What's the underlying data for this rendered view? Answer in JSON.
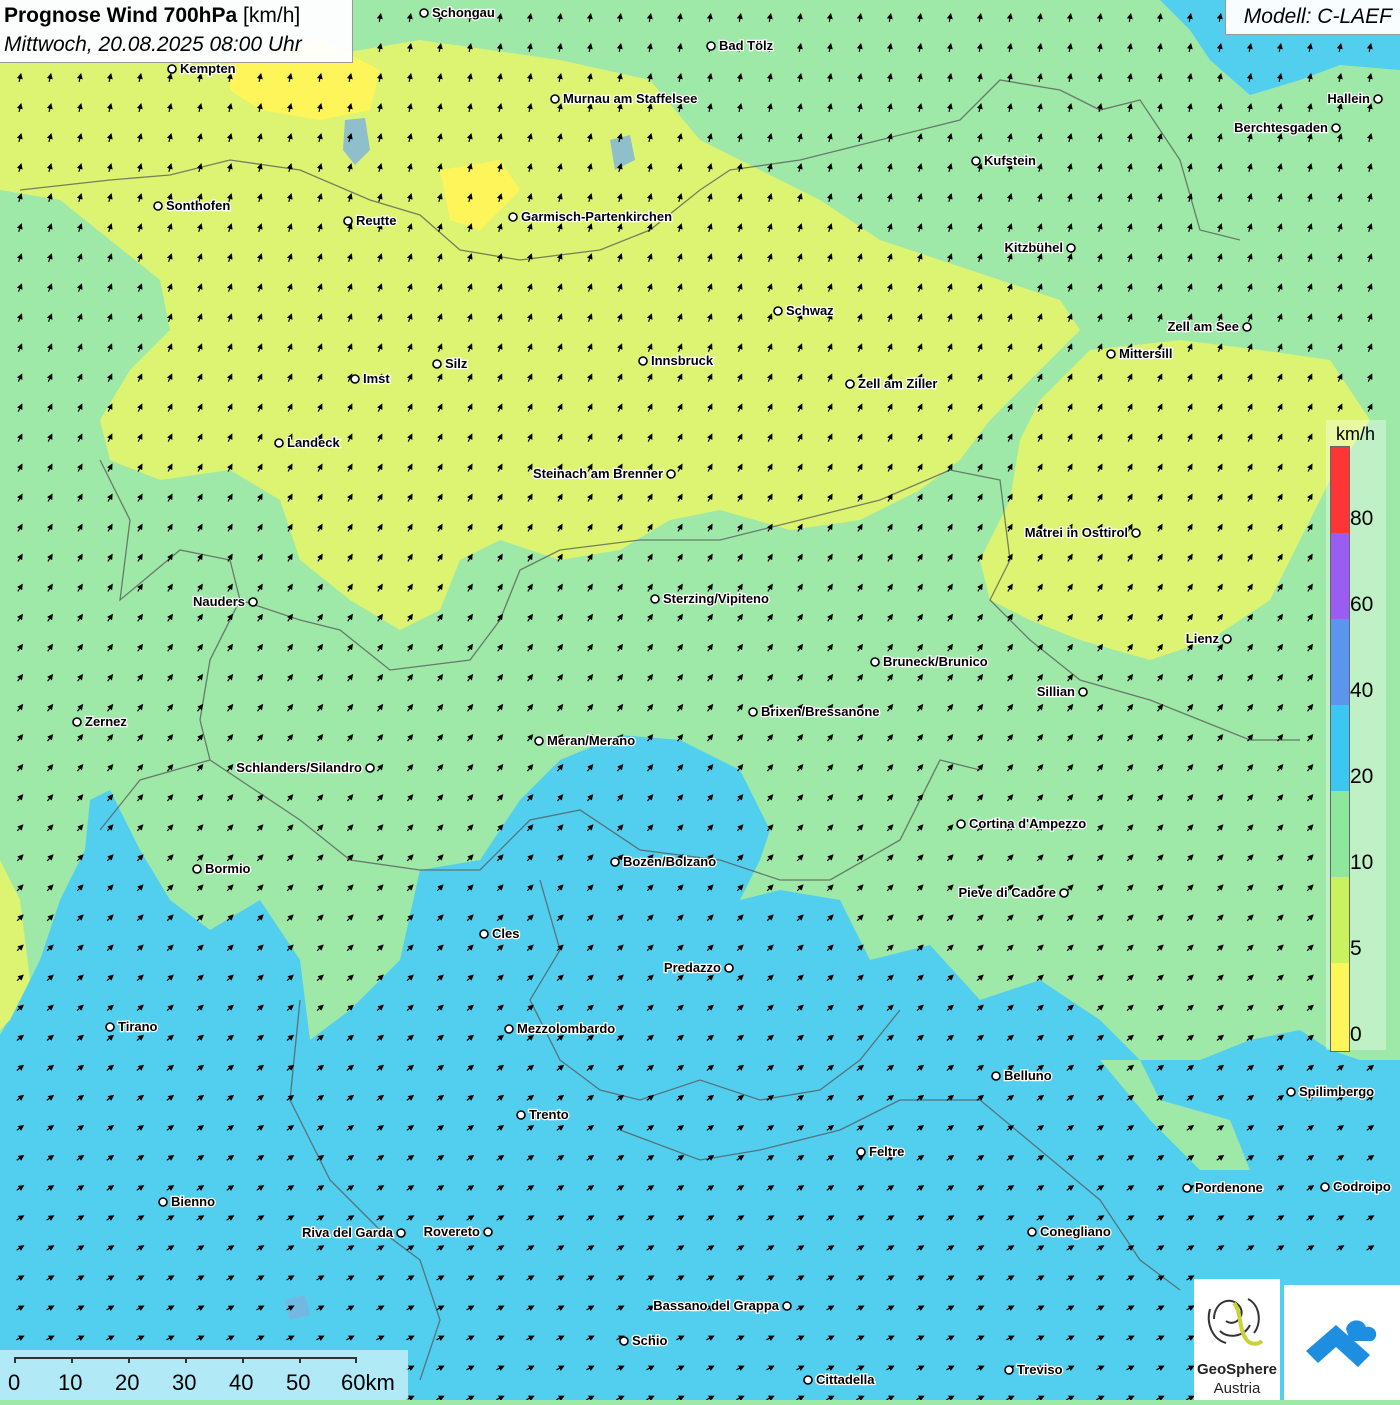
{
  "header": {
    "title_bold": "Prognose Wind 700hPa",
    "title_unit": " [km/h]",
    "datetime": "Mittwoch, 20.08.2025 08:00 Uhr",
    "model": "Modell: C-LAEF"
  },
  "legend": {
    "unit": "km/h",
    "labels": [
      "80",
      "60",
      "40",
      "20",
      "10",
      "5",
      "0"
    ],
    "colors": [
      "#ff3434",
      "#9b5cf2",
      "#5b95ee",
      "#3cc6f2",
      "#8ee89b",
      "#c9f25f",
      "#fdf55a"
    ]
  },
  "colors": {
    "calm": "#fdf55a",
    "light": "#ddf472",
    "moderate": "#9ee8a8",
    "fresh": "#52cfee",
    "lake": "#7ab2e0",
    "border": "#555555"
  },
  "scale": {
    "labels": [
      "0",
      "10",
      "20",
      "30",
      "40",
      "50",
      "60km"
    ]
  },
  "logos": {
    "geosphere_line1": "GeoSphere",
    "geosphere_line2": "Austria"
  },
  "cities": [
    {
      "name": "Schongau"
    },
    {
      "name": "Bad Tölz"
    },
    {
      "name": "Kempten"
    },
    {
      "name": "Murnau am Staffelsee"
    },
    {
      "name": "Hallein"
    },
    {
      "name": "Berchtesgaden"
    },
    {
      "name": "Kufstein"
    },
    {
      "name": "Sonthofen"
    },
    {
      "name": "Reutte"
    },
    {
      "name": "Garmisch-Partenkirchen"
    },
    {
      "name": "Kitzbühel"
    },
    {
      "name": "Schwaz"
    },
    {
      "name": "Zell am See"
    },
    {
      "name": "Mittersill"
    },
    {
      "name": "Silz"
    },
    {
      "name": "Innsbruck"
    },
    {
      "name": "Imst"
    },
    {
      "name": "Zell am Ziller"
    },
    {
      "name": "Landeck"
    },
    {
      "name": "Steinach am Brenner"
    },
    {
      "name": "Matrei in Osttirol"
    },
    {
      "name": "Nauders"
    },
    {
      "name": "Sterzing/Vipiteno"
    },
    {
      "name": "Lienz"
    },
    {
      "name": "Bruneck/Brunico"
    },
    {
      "name": "Sillian"
    },
    {
      "name": "Zernez"
    },
    {
      "name": "Brixen/Bressanone"
    },
    {
      "name": "Meran/Merano"
    },
    {
      "name": "Schlanders/Silandro"
    },
    {
      "name": "Cortina d'Ampezzo"
    },
    {
      "name": "Bozen/Bolzano"
    },
    {
      "name": "Bormio"
    },
    {
      "name": "Pieve di Cadore"
    },
    {
      "name": "Cles"
    },
    {
      "name": "Predazzo"
    },
    {
      "name": "Tirano"
    },
    {
      "name": "Mezzolombardo"
    },
    {
      "name": "Belluno"
    },
    {
      "name": "Spilimbergo"
    },
    {
      "name": "Trento"
    },
    {
      "name": "Feltre"
    },
    {
      "name": "Pordenone"
    },
    {
      "name": "Codroipo"
    },
    {
      "name": "Bienno"
    },
    {
      "name": "Riva del Garda"
    },
    {
      "name": "Rovereto"
    },
    {
      "name": "Conegliano"
    },
    {
      "name": "Bassano del Grappa"
    },
    {
      "name": "Schio"
    },
    {
      "name": "Treviso"
    },
    {
      "name": "Cittadella"
    }
  ]
}
